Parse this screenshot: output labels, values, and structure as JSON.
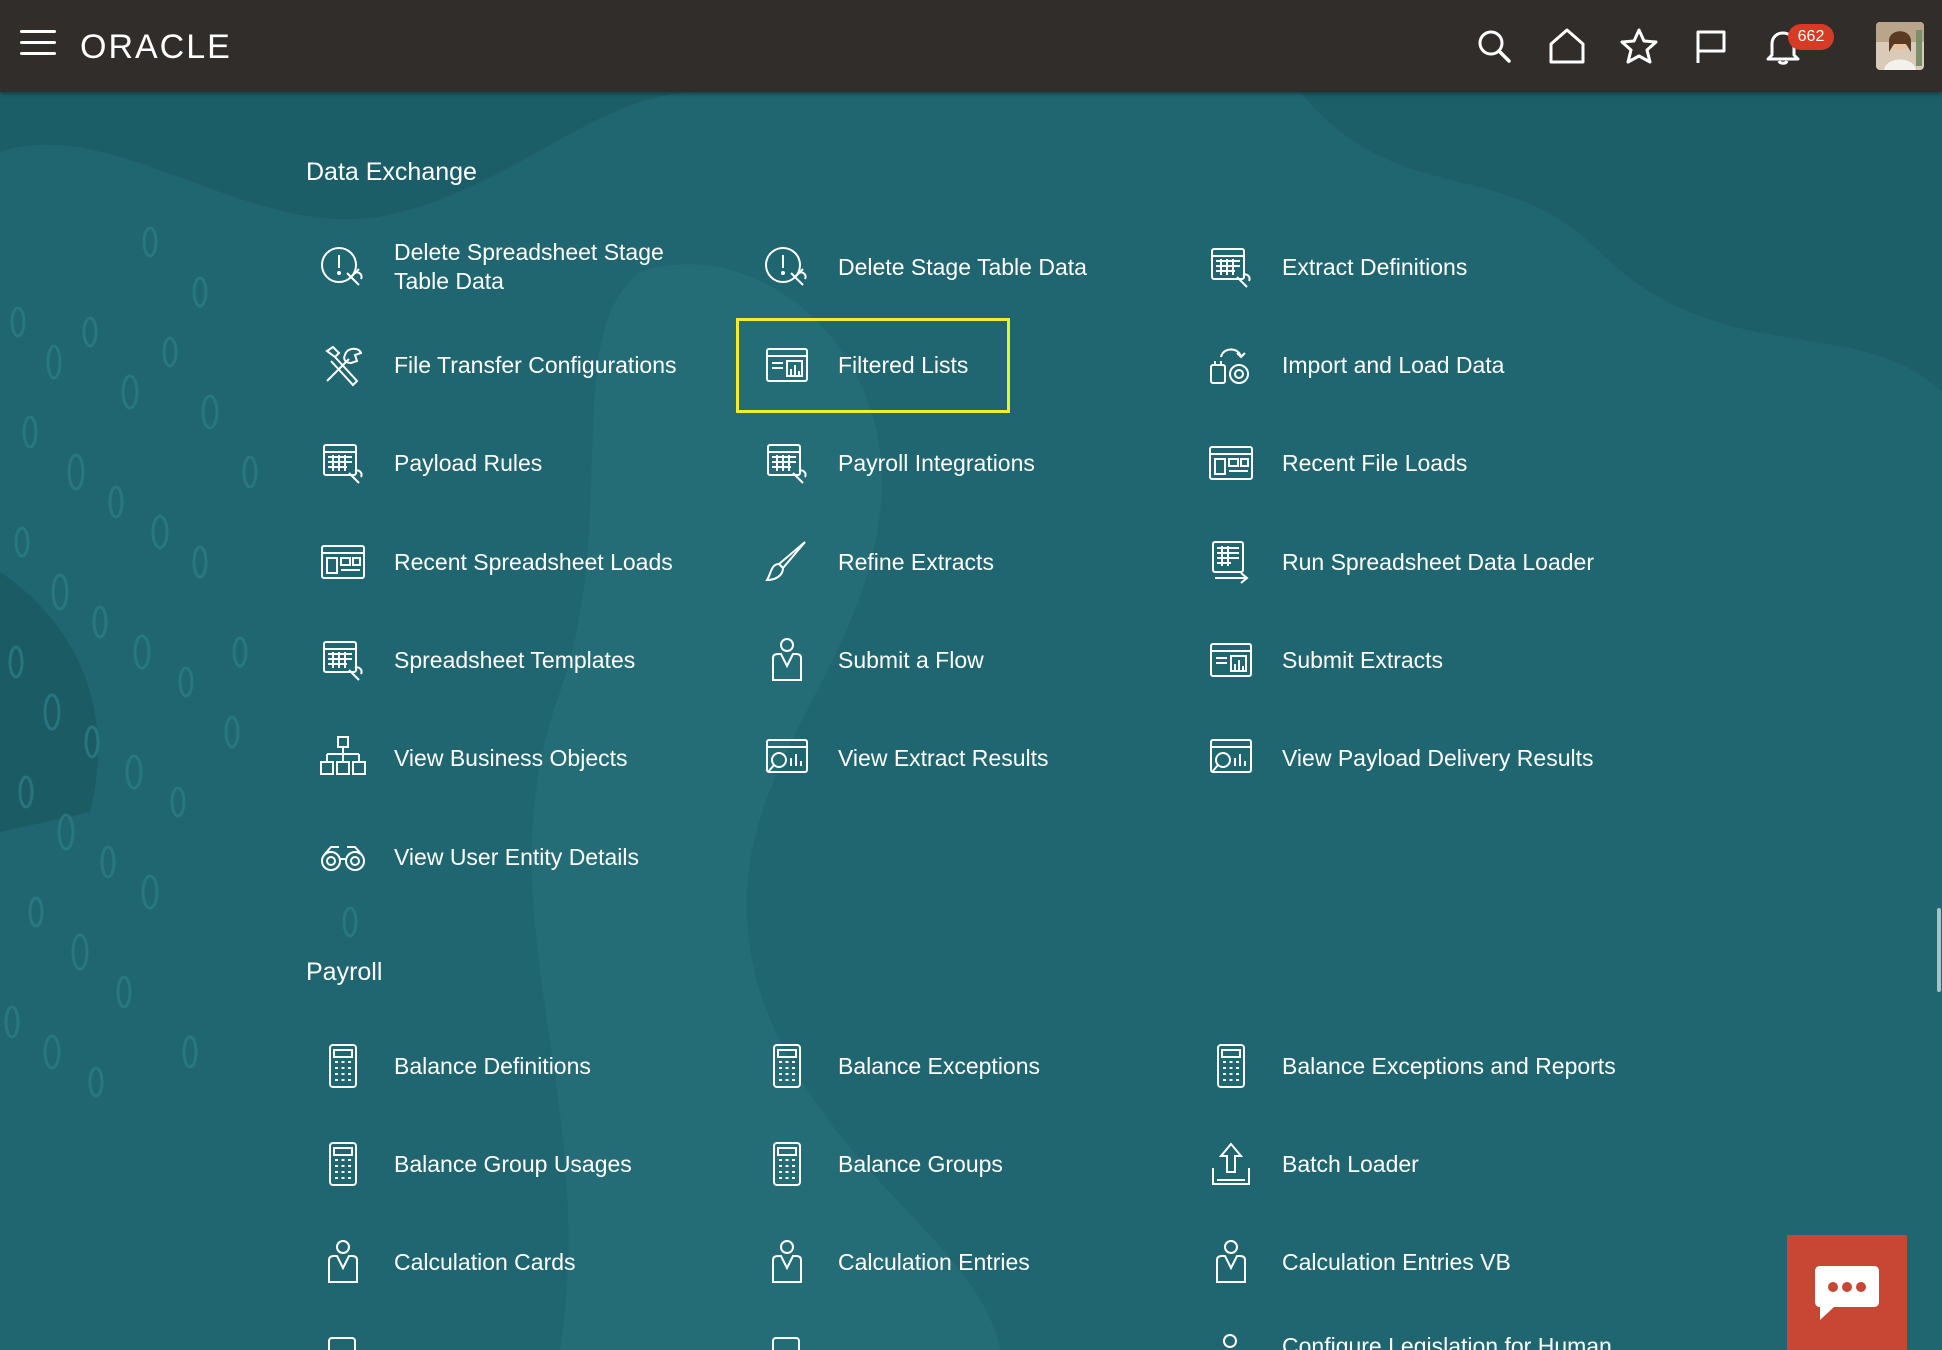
{
  "header": {
    "brand": "ORACLE",
    "notification_count": "662",
    "icons": [
      "menu-icon",
      "search-icon",
      "home-icon",
      "favorites-icon",
      "flag-icon",
      "bell-icon"
    ],
    "colors": {
      "bar": "#312d2a",
      "badge": "#d63b25",
      "background": "#1f6670",
      "highlight": "#f0ee2a",
      "chat": "#c74634"
    }
  },
  "data_exchange": {
    "title": "Data Exchange",
    "items": [
      {
        "label": "Delete Spreadsheet Stage Table Data",
        "icon": "alert-wrench-icon"
      },
      {
        "label": "Delete Stage Table Data",
        "icon": "alert-wrench-icon"
      },
      {
        "label": "Extract Definitions",
        "icon": "sheet-wrench-icon"
      },
      {
        "label": "File Transfer Configurations",
        "icon": "tools-icon"
      },
      {
        "label": "Filtered Lists",
        "icon": "report-chart-icon"
      },
      {
        "label": "Import and Load Data",
        "icon": "import-load-icon"
      },
      {
        "label": "Payload Rules",
        "icon": "sheet-wrench-icon"
      },
      {
        "label": "Payroll Integrations",
        "icon": "sheet-wrench-icon"
      },
      {
        "label": "Recent File Loads",
        "icon": "dashboard-icon"
      },
      {
        "label": "Recent Spreadsheet Loads",
        "icon": "dashboard-icon"
      },
      {
        "label": "Refine Extracts",
        "icon": "brush-icon"
      },
      {
        "label": "Run Spreadsheet Data Loader",
        "icon": "sheet-arrow-icon"
      },
      {
        "label": "Spreadsheet Templates",
        "icon": "sheet-wrench-icon"
      },
      {
        "label": "Submit a Flow",
        "icon": "person-check-icon"
      },
      {
        "label": "Submit Extracts",
        "icon": "report-chart-icon"
      },
      {
        "label": "View Business Objects",
        "icon": "hierarchy-icon"
      },
      {
        "label": "View Extract Results",
        "icon": "report-search-icon"
      },
      {
        "label": "View Payload Delivery Results",
        "icon": "report-search-icon"
      },
      {
        "label": "View User Entity Details",
        "icon": "binoculars-icon"
      }
    ]
  },
  "payroll": {
    "title": "Payroll",
    "items": [
      {
        "label": "Balance Definitions",
        "icon": "calculator-icon"
      },
      {
        "label": "Balance Exceptions",
        "icon": "calculator-icon"
      },
      {
        "label": "Balance Exceptions and Reports",
        "icon": "calculator-icon"
      },
      {
        "label": "Balance Group Usages",
        "icon": "calculator-icon"
      },
      {
        "label": "Balance Groups",
        "icon": "calculator-icon"
      },
      {
        "label": "Batch Loader",
        "icon": "upload-icon"
      },
      {
        "label": "Calculation Cards",
        "icon": "person-check-icon"
      },
      {
        "label": "Calculation Entries",
        "icon": "person-check-icon"
      },
      {
        "label": "Calculation Entries VB",
        "icon": "person-check-icon"
      },
      {
        "label": "Configure Legislation for Human",
        "icon": "person-check-icon"
      }
    ]
  }
}
